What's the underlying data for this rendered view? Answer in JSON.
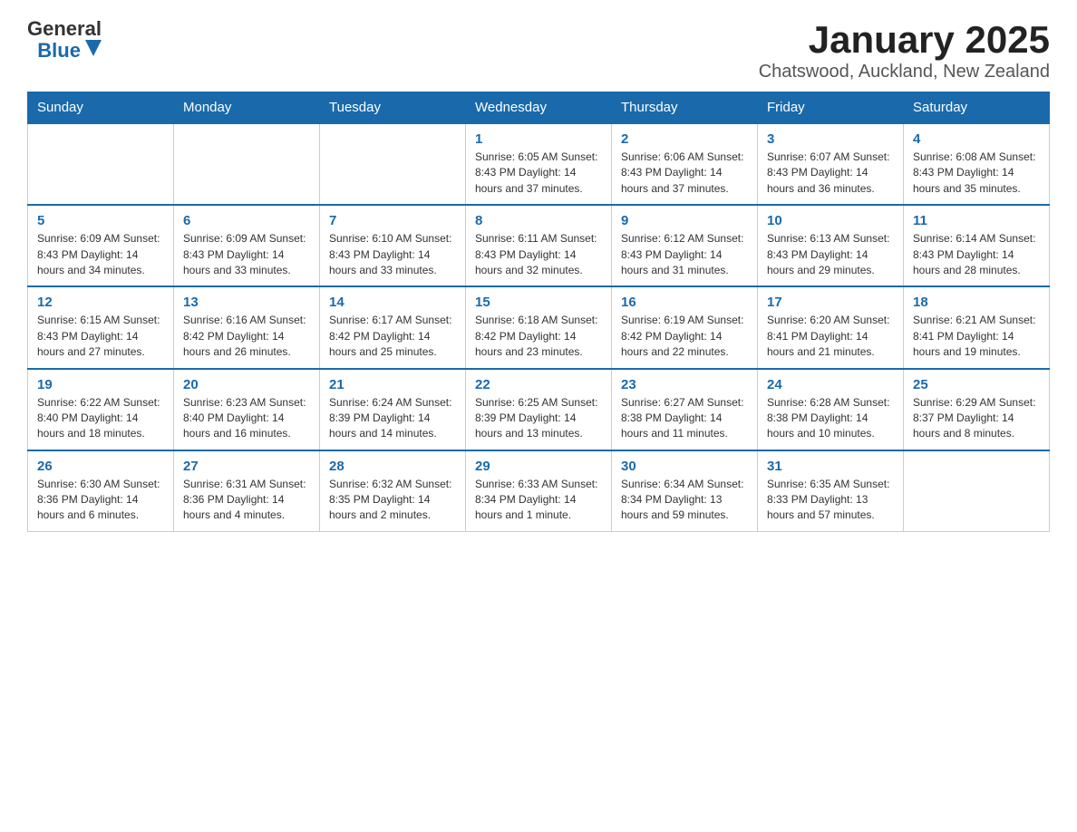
{
  "header": {
    "logo_general": "General",
    "logo_blue": "Blue",
    "title": "January 2025",
    "subtitle": "Chatswood, Auckland, New Zealand"
  },
  "weekdays": [
    "Sunday",
    "Monday",
    "Tuesday",
    "Wednesday",
    "Thursday",
    "Friday",
    "Saturday"
  ],
  "weeks": [
    [
      {
        "num": "",
        "info": ""
      },
      {
        "num": "",
        "info": ""
      },
      {
        "num": "",
        "info": ""
      },
      {
        "num": "1",
        "info": "Sunrise: 6:05 AM\nSunset: 8:43 PM\nDaylight: 14 hours and 37 minutes."
      },
      {
        "num": "2",
        "info": "Sunrise: 6:06 AM\nSunset: 8:43 PM\nDaylight: 14 hours and 37 minutes."
      },
      {
        "num": "3",
        "info": "Sunrise: 6:07 AM\nSunset: 8:43 PM\nDaylight: 14 hours and 36 minutes."
      },
      {
        "num": "4",
        "info": "Sunrise: 6:08 AM\nSunset: 8:43 PM\nDaylight: 14 hours and 35 minutes."
      }
    ],
    [
      {
        "num": "5",
        "info": "Sunrise: 6:09 AM\nSunset: 8:43 PM\nDaylight: 14 hours and 34 minutes."
      },
      {
        "num": "6",
        "info": "Sunrise: 6:09 AM\nSunset: 8:43 PM\nDaylight: 14 hours and 33 minutes."
      },
      {
        "num": "7",
        "info": "Sunrise: 6:10 AM\nSunset: 8:43 PM\nDaylight: 14 hours and 33 minutes."
      },
      {
        "num": "8",
        "info": "Sunrise: 6:11 AM\nSunset: 8:43 PM\nDaylight: 14 hours and 32 minutes."
      },
      {
        "num": "9",
        "info": "Sunrise: 6:12 AM\nSunset: 8:43 PM\nDaylight: 14 hours and 31 minutes."
      },
      {
        "num": "10",
        "info": "Sunrise: 6:13 AM\nSunset: 8:43 PM\nDaylight: 14 hours and 29 minutes."
      },
      {
        "num": "11",
        "info": "Sunrise: 6:14 AM\nSunset: 8:43 PM\nDaylight: 14 hours and 28 minutes."
      }
    ],
    [
      {
        "num": "12",
        "info": "Sunrise: 6:15 AM\nSunset: 8:43 PM\nDaylight: 14 hours and 27 minutes."
      },
      {
        "num": "13",
        "info": "Sunrise: 6:16 AM\nSunset: 8:42 PM\nDaylight: 14 hours and 26 minutes."
      },
      {
        "num": "14",
        "info": "Sunrise: 6:17 AM\nSunset: 8:42 PM\nDaylight: 14 hours and 25 minutes."
      },
      {
        "num": "15",
        "info": "Sunrise: 6:18 AM\nSunset: 8:42 PM\nDaylight: 14 hours and 23 minutes."
      },
      {
        "num": "16",
        "info": "Sunrise: 6:19 AM\nSunset: 8:42 PM\nDaylight: 14 hours and 22 minutes."
      },
      {
        "num": "17",
        "info": "Sunrise: 6:20 AM\nSunset: 8:41 PM\nDaylight: 14 hours and 21 minutes."
      },
      {
        "num": "18",
        "info": "Sunrise: 6:21 AM\nSunset: 8:41 PM\nDaylight: 14 hours and 19 minutes."
      }
    ],
    [
      {
        "num": "19",
        "info": "Sunrise: 6:22 AM\nSunset: 8:40 PM\nDaylight: 14 hours and 18 minutes."
      },
      {
        "num": "20",
        "info": "Sunrise: 6:23 AM\nSunset: 8:40 PM\nDaylight: 14 hours and 16 minutes."
      },
      {
        "num": "21",
        "info": "Sunrise: 6:24 AM\nSunset: 8:39 PM\nDaylight: 14 hours and 14 minutes."
      },
      {
        "num": "22",
        "info": "Sunrise: 6:25 AM\nSunset: 8:39 PM\nDaylight: 14 hours and 13 minutes."
      },
      {
        "num": "23",
        "info": "Sunrise: 6:27 AM\nSunset: 8:38 PM\nDaylight: 14 hours and 11 minutes."
      },
      {
        "num": "24",
        "info": "Sunrise: 6:28 AM\nSunset: 8:38 PM\nDaylight: 14 hours and 10 minutes."
      },
      {
        "num": "25",
        "info": "Sunrise: 6:29 AM\nSunset: 8:37 PM\nDaylight: 14 hours and 8 minutes."
      }
    ],
    [
      {
        "num": "26",
        "info": "Sunrise: 6:30 AM\nSunset: 8:36 PM\nDaylight: 14 hours and 6 minutes."
      },
      {
        "num": "27",
        "info": "Sunrise: 6:31 AM\nSunset: 8:36 PM\nDaylight: 14 hours and 4 minutes."
      },
      {
        "num": "28",
        "info": "Sunrise: 6:32 AM\nSunset: 8:35 PM\nDaylight: 14 hours and 2 minutes."
      },
      {
        "num": "29",
        "info": "Sunrise: 6:33 AM\nSunset: 8:34 PM\nDaylight: 14 hours and 1 minute."
      },
      {
        "num": "30",
        "info": "Sunrise: 6:34 AM\nSunset: 8:34 PM\nDaylight: 13 hours and 59 minutes."
      },
      {
        "num": "31",
        "info": "Sunrise: 6:35 AM\nSunset: 8:33 PM\nDaylight: 13 hours and 57 minutes."
      },
      {
        "num": "",
        "info": ""
      }
    ]
  ]
}
